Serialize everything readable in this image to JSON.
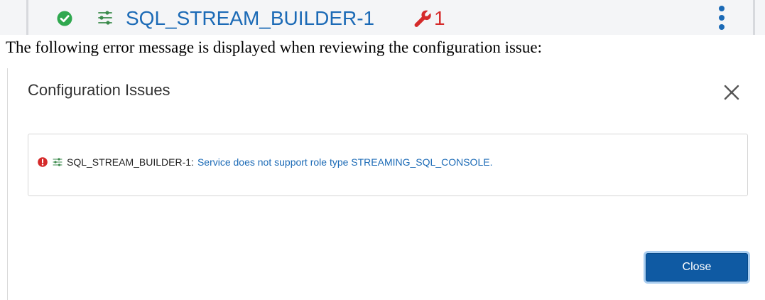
{
  "service_bar": {
    "status_icon": "check-circle-icon",
    "service_type_icon": "stream-builder-icon",
    "service_name": "SQL_STREAM_BUILDER-1",
    "config_issues_icon": "wrench-icon",
    "config_issues_count": "1",
    "menu_icon": "kebab-menu-icon",
    "background_color": "#f4f5f7"
  },
  "caption": "The following error message is displayed when reviewing the configuration issue:",
  "dialog": {
    "title": "Configuration Issues",
    "close_icon": "close-icon",
    "issues": [
      {
        "severity_icon": "error-icon",
        "service_type_icon": "stream-builder-icon",
        "service": "SQL_STREAM_BUILDER-1:",
        "message": "Service does not support role type STREAMING_SQL_CONSOLE."
      }
    ],
    "close_button": "Close"
  },
  "colors": {
    "link_blue": "#1b6ab6",
    "status_green": "#2fa84f",
    "error_red": "#d52a2a",
    "primary_button": "#0f5aa3",
    "button_focus_ring": "#a9cdf0"
  }
}
